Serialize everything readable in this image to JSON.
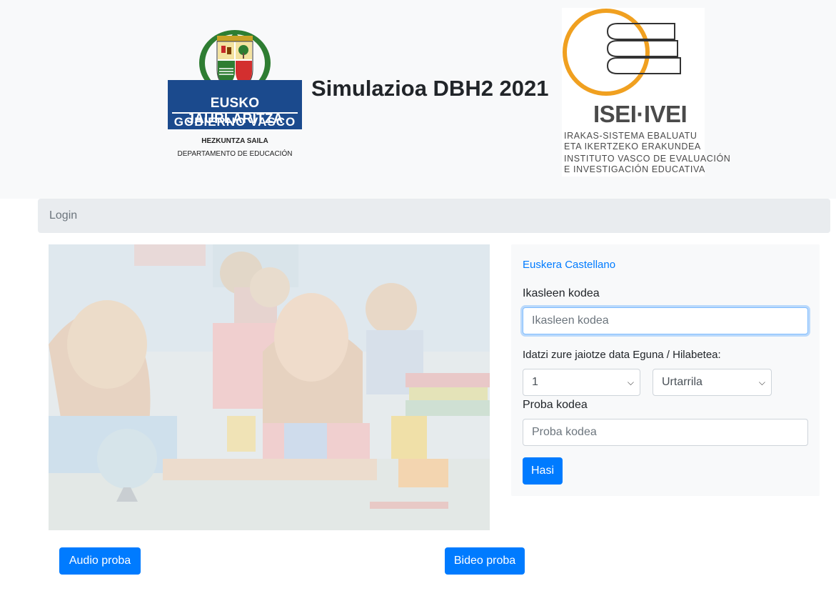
{
  "header": {
    "title": "Simulazioa DBH2 2021",
    "logo_left": {
      "line1": "EUSKO JAURLARITZA",
      "line2": "GOBIERNO VASCO",
      "dept_eu": "HEZKUNTZA SAILA",
      "dept_es": "DEPARTAMENTO DE EDUCACIÓN"
    },
    "logo_right": {
      "name": "ISEI·IVEI",
      "lines": [
        "IRAKAS-SISTEMA EBALUATU",
        "ETA IKERTZEKO ERAKUNDEA",
        "INSTITUTO VASCO DE EVALUACIÓN",
        "E  INVESTIGACIÓN  EDUCATIVA"
      ]
    }
  },
  "breadcrumb": {
    "label": "Login"
  },
  "form": {
    "lang_eu": "Euskera",
    "lang_es": "Castellano",
    "student_code_label": "Ikasleen kodea",
    "student_code_placeholder": "Ikasleen kodea",
    "birthdate_label": "Idatzi zure jaiotze data Eguna / Hilabetea:",
    "day_value": "1",
    "month_value": "Urtarrila",
    "test_code_label": "Proba kodea",
    "test_code_placeholder": "Proba kodea",
    "submit_label": "Hasi"
  },
  "footer": {
    "audio_label": "Audio proba",
    "video_label": "Bideo proba"
  },
  "colors": {
    "primary": "#007bff",
    "header_bg": "#f8f9fa",
    "breadcrumb_bg": "#e9ecef",
    "ej_blue": "#1b4a8d",
    "isei_orange": "#f0a020"
  },
  "icons": [
    "basque-coat-of-arms-icon",
    "books-logo-icon",
    "chevron-down-icon"
  ]
}
